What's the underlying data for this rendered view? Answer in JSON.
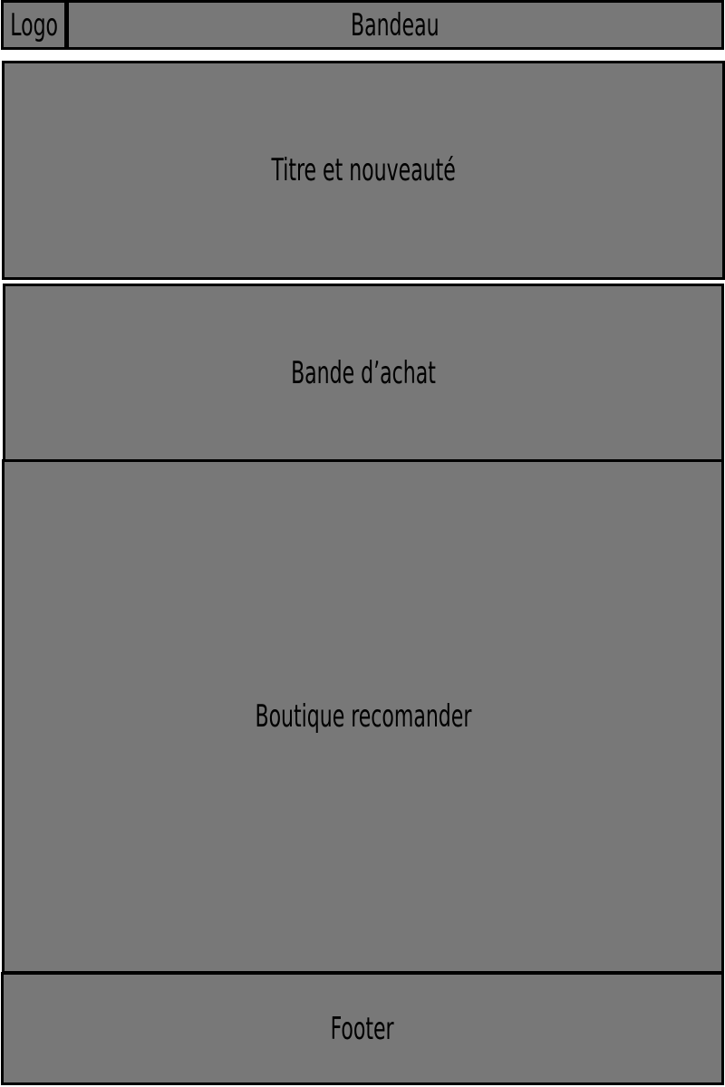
{
  "header": {
    "logo_label": "Logo",
    "banner_label": "Bandeau"
  },
  "sections": {
    "title": "Titre et nouveauté",
    "purchase_band": "Bande d’achat",
    "shop": "Boutique recomander",
    "footer": "Footer"
  },
  "colors": {
    "block_fill": "#787878",
    "border": "#000000",
    "background": "#ffffff"
  }
}
